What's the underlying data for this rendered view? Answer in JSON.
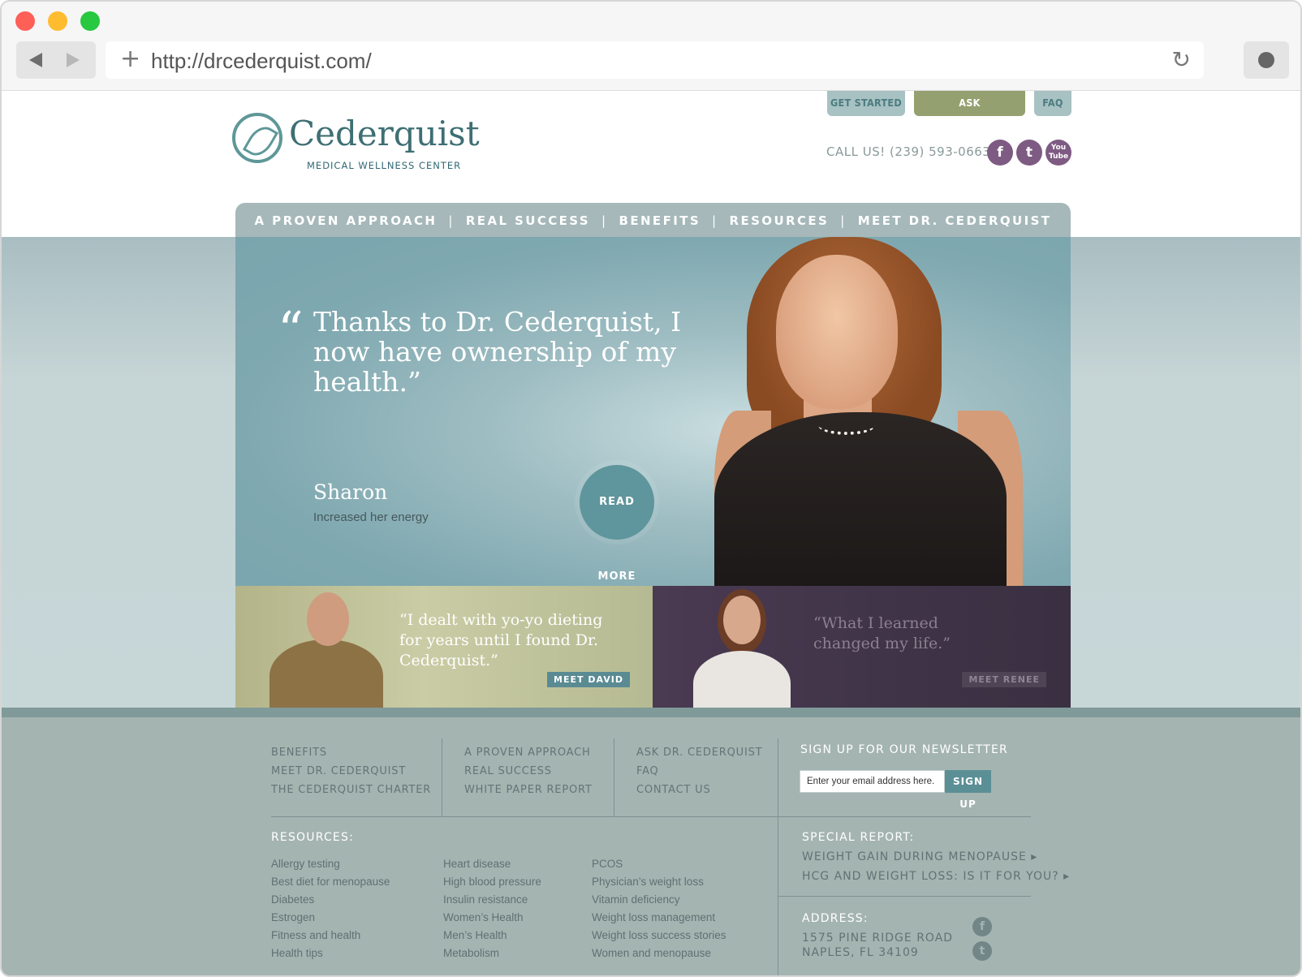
{
  "browser": {
    "url": "http://drcederquist.com/"
  },
  "header": {
    "brand_name": "Cederquist",
    "brand_sub": "MEDICAL WELLNESS CENTER",
    "top_tabs": [
      "GET STARTED",
      "ASK DR.CEDERQUIST",
      "FAQ"
    ],
    "call_us": "CALL US! (239) 593-0663",
    "social": [
      "f",
      "t",
      "You Tube"
    ]
  },
  "nav": {
    "items": [
      "A PROVEN APPROACH",
      "REAL SUCCESS",
      "BENEFITS",
      "RESOURCES",
      "MEET DR. CEDERQUIST"
    ]
  },
  "hero": {
    "quote_mark": "“",
    "quote": "Thanks to Dr. Cederquist, I now have ownership of my health.”",
    "name": "Sharon",
    "caption": "Increased her energy",
    "button": "READ MORE"
  },
  "panels": {
    "david": {
      "quote": "“I dealt with yo-yo dieting for years until I found Dr. Cederquist.”",
      "button": "MEET DAVID"
    },
    "renee": {
      "quote": "“What I learned changed my life.”",
      "button": "MEET RENEE"
    }
  },
  "footer": {
    "col1": [
      "BENEFITS",
      "MEET DR. CEDERQUIST",
      "THE CEDERQUIST CHARTER"
    ],
    "col2": [
      "A PROVEN APPROACH",
      "REAL SUCCESS",
      "WHITE PAPER REPORT"
    ],
    "col3": [
      "ASK DR. CEDERQUIST",
      "FAQ",
      "CONTACT US"
    ],
    "newsletter_title": "SIGN UP FOR OUR NEWSLETTER",
    "newsletter_placeholder": "Enter your email address here.",
    "newsletter_button": "SIGN UP",
    "resources_title": "RESOURCES:",
    "resources": {
      "c1": [
        "Allergy testing",
        "Best diet for menopause",
        "Diabetes",
        "Estrogen",
        "Fitness and health",
        "Health tips"
      ],
      "c2": [
        "Heart disease",
        "High blood pressure",
        "Insulin resistance",
        "Women’s Health",
        "Men’s Health",
        "Metabolism"
      ],
      "c3": [
        "PCOS",
        "Physician’s weight loss",
        "Vitamin deficiency",
        "Weight loss management",
        "Weight loss success stories",
        "Women and menopause"
      ]
    },
    "special_report_title": "SPECIAL REPORT:",
    "special_reports": [
      "WEIGHT GAIN DURING MENOPAUSE ▸",
      "HCG AND WEIGHT LOSS: IS IT FOR YOU? ▸"
    ],
    "address_title": "ADDRESS:",
    "address_line1": "1575 PINE RIDGE ROAD",
    "address_line2": "NAPLES, FL 34109"
  }
}
